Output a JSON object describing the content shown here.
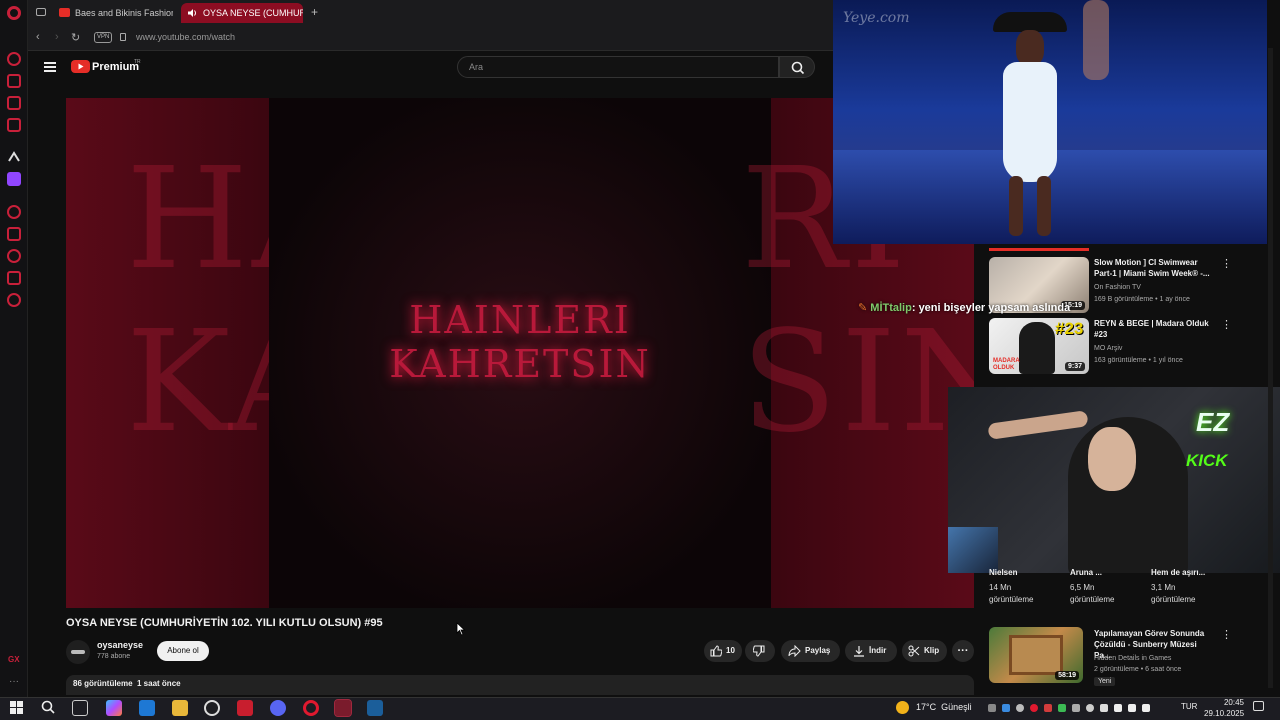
{
  "browser": {
    "tabs": [
      {
        "label": "Baes and Bikinis Fashion",
        "active": false
      },
      {
        "label": "OYSA NEYSE (CUMHUR",
        "active": true
      }
    ],
    "vpn_label": "VPN",
    "url": "www.youtube.com/watch"
  },
  "youtube": {
    "logo_text": "Premium",
    "logo_sup": "TR",
    "search_placeholder": "Ara",
    "poster": {
      "line1": "HAINLERI",
      "line2": "KAHRETSIN"
    },
    "video_title": "OYSA NEYSE (CUMHURİYETİN 102. YILI KUTLU OLSUN) #95",
    "channel_name": "oysaneyse",
    "subscribers": "778 abone",
    "subscribe_label": "Abone ol",
    "likes": "10",
    "share_label": "Paylaş",
    "download_label": "İndir",
    "clip_label": "Klip",
    "views_line": "86 görüntüleme  1 saat önce",
    "recommendations": [
      {
        "title": "Slow Motion ] CI Swimwear Part-1 | Miami Swim Week® -...",
        "channel": "On Fashion TV",
        "meta": "169 B görüntüleme • 1 ay önce",
        "duration": "15:19"
      },
      {
        "title": "REYN & BEGE | Madara Olduk #23",
        "channel": "MO Arşiv",
        "meta": "163 görüntüleme • 1 yıl önce",
        "duration": "9:37"
      },
      {
        "title": "Yapılamayan Görev Sonunda Çözüldü - Sunberry Müzesi Pa...",
        "channel": "Hidden Details in Games",
        "meta": "2 görüntüleme • 6 saat önce",
        "duration": "58:19",
        "badge": "Yeni"
      }
    ],
    "shorts_row": [
      {
        "title": "Nielsen",
        "count": "14 Mn",
        "unit": "görüntüleme"
      },
      {
        "title": "Aruna ...",
        "count": "6,5 Mn",
        "unit": "görüntüleme"
      },
      {
        "title": "Hem de aşırı...",
        "count": "3,1 Mn",
        "unit": "görüntüleme"
      }
    ]
  },
  "stream": {
    "chat_user": "MİTtalip",
    "chat_message": ": yeni bişeyler yapsam aslında",
    "runway_watermark": "Yeye.com",
    "webcam_logo_top": "EZ",
    "webcam_logo_bottom": "KICK",
    "thumb_text": "#23",
    "thumb_text2": "MADARA OLDUK"
  },
  "taskbar": {
    "weather": "17°C  Güneşli",
    "language": "TUR",
    "time": "20:45",
    "date": "29.10.2025"
  },
  "colors": {
    "accent": "#e52d27",
    "opera_red": "#c8203a",
    "kick_green": "#53fc18"
  }
}
